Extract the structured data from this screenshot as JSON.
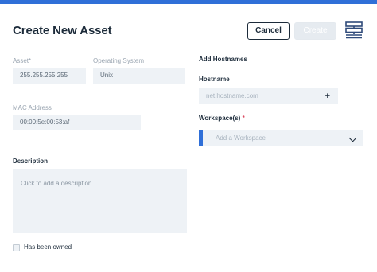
{
  "header": {
    "title": "Create New Asset",
    "cancel_label": "Cancel",
    "create_label": "Create",
    "layout_icon": "server-stack-icon"
  },
  "form": {
    "asset": {
      "label": "Asset",
      "required_mark": "*",
      "value": "255.255.255.255"
    },
    "os": {
      "label": "Operating System",
      "value": "Unix"
    },
    "mac": {
      "label": "MAC Address",
      "value": "00:00:5e:00:53:af"
    },
    "description": {
      "label": "Description",
      "placeholder": "Click to add a description."
    },
    "owned": {
      "label": "Has been owned",
      "checked": false
    }
  },
  "hostnames": {
    "section_title": "Add Hostnames",
    "label": "Hostname",
    "placeholder": "net.hostname.com",
    "add_icon": "plus-icon",
    "add_symbol": "+"
  },
  "workspaces": {
    "label": "Workspace(s)",
    "required_mark": "*",
    "placeholder": "Add a Workspace",
    "dropdown_icon": "chevron-down-icon"
  },
  "colors": {
    "accent": "#2f6fd8",
    "text": "#1c2b3a",
    "muted": "#9aa5b1",
    "field_bg": "#eef2f6",
    "required": "#d9435a"
  }
}
